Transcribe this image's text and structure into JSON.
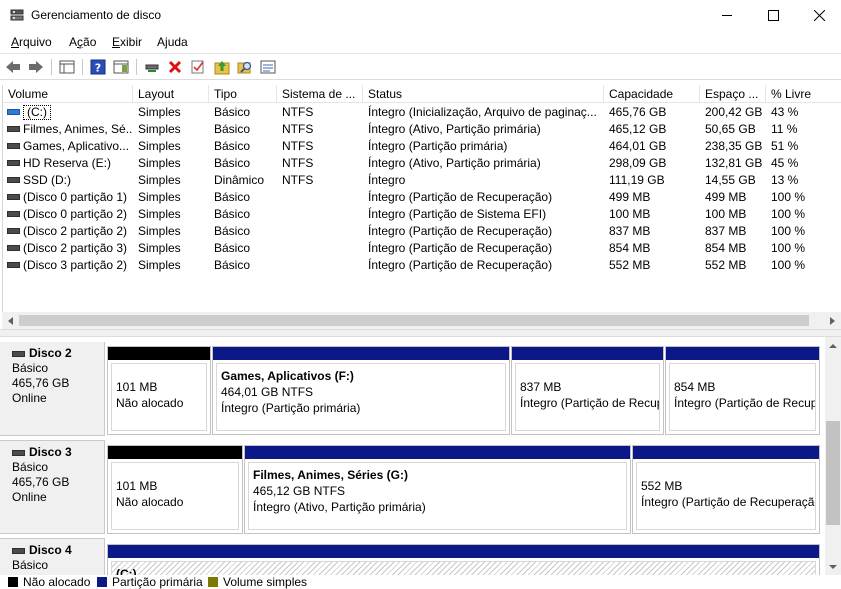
{
  "window": {
    "title": "Gerenciamento de disco",
    "controls": {
      "minimize": "minimize-icon",
      "maximize": "maximize-icon",
      "close": "close-icon"
    }
  },
  "menu": [
    {
      "label": "Arquivo",
      "u": "A",
      "rest": "rquivo"
    },
    {
      "label": "Ação",
      "u": "ç",
      "pre": "A",
      "rest": "ão"
    },
    {
      "label": "Exibir",
      "u": "E",
      "rest": "xibir"
    },
    {
      "label": "Ajuda",
      "u": "j",
      "pre": "A",
      "rest": "uda"
    }
  ],
  "menu_display": {
    "arquivo_u": "A",
    "arquivo_rest": "rquivo",
    "acao_pre": "A",
    "acao_u": "ç",
    "acao_rest": "ão",
    "exibir_u": "E",
    "exibir_rest": "xibir",
    "ajuda_pre": "A",
    "ajuda_u": "j",
    "ajuda_rest": "uda"
  },
  "toolbar": [
    "back-arrow-icon",
    "forward-arrow-icon",
    "console-tree-icon",
    "help-icon",
    "action-pane-icon",
    "connect-drive-icon",
    "delete-icon",
    "check-icon",
    "folder-up-icon",
    "search-icon",
    "properties-icon"
  ],
  "columns": {
    "volume": "Volume",
    "layout": "Layout",
    "tipo": "Tipo",
    "sistema": "Sistema de ...",
    "status": "Status",
    "capacidade": "Capacidade",
    "espaco": "Espaço ...",
    "livre": "% Livre"
  },
  "volumes": [
    {
      "volume": "(C:)",
      "layout": "Simples",
      "tipo": "Básico",
      "sistema": "NTFS",
      "status": "Íntegro (Inicialização, Arquivo de paginaç...",
      "capacidade": "465,76 GB",
      "espaco": "200,42 GB",
      "livre": "43 %"
    },
    {
      "volume": "Filmes, Animes, Sé...",
      "layout": "Simples",
      "tipo": "Básico",
      "sistema": "NTFS",
      "status": "Íntegro (Ativo, Partição primária)",
      "capacidade": "465,12 GB",
      "espaco": "50,65 GB",
      "livre": "11 %"
    },
    {
      "volume": "Games, Aplicativo...",
      "layout": "Simples",
      "tipo": "Básico",
      "sistema": "NTFS",
      "status": "Íntegro (Partição primária)",
      "capacidade": "464,01 GB",
      "espaco": "238,35 GB",
      "livre": "51 %"
    },
    {
      "volume": "HD Reserva (E:)",
      "layout": "Simples",
      "tipo": "Básico",
      "sistema": "NTFS",
      "status": "Íntegro (Ativo, Partição primária)",
      "capacidade": "298,09 GB",
      "espaco": "132,81 GB",
      "livre": "45 %"
    },
    {
      "volume": "SSD (D:)",
      "layout": "Simples",
      "tipo": "Dinâmico",
      "sistema": "NTFS",
      "status": "Íntegro",
      "capacidade": "111,19 GB",
      "espaco": "14,55 GB",
      "livre": "13 %"
    },
    {
      "volume": "(Disco 0 partição 1)",
      "layout": "Simples",
      "tipo": "Básico",
      "sistema": "",
      "status": "Íntegro (Partição de Recuperação)",
      "capacidade": "499 MB",
      "espaco": "499 MB",
      "livre": "100 %"
    },
    {
      "volume": "(Disco 0 partição 2)",
      "layout": "Simples",
      "tipo": "Básico",
      "sistema": "",
      "status": "Íntegro (Partição de Sistema EFI)",
      "capacidade": "100 MB",
      "espaco": "100 MB",
      "livre": "100 %"
    },
    {
      "volume": "(Disco 2 partição 2)",
      "layout": "Simples",
      "tipo": "Básico",
      "sistema": "",
      "status": "Íntegro (Partição de Recuperação)",
      "capacidade": "837 MB",
      "espaco": "837 MB",
      "livre": "100 %"
    },
    {
      "volume": "(Disco 2 partição 3)",
      "layout": "Simples",
      "tipo": "Básico",
      "sistema": "",
      "status": "Íntegro (Partição de Recuperação)",
      "capacidade": "854 MB",
      "espaco": "854 MB",
      "livre": "100 %"
    },
    {
      "volume": "(Disco 3 partição 2)",
      "layout": "Simples",
      "tipo": "Básico",
      "sistema": "",
      "status": "Íntegro (Partição de Recuperação)",
      "capacidade": "552 MB",
      "espaco": "552 MB",
      "livre": "100 %"
    }
  ],
  "disks": [
    {
      "name": "Disco 2",
      "type": "Básico",
      "size": "465,76 GB",
      "state": "Online",
      "partitions": [
        {
          "line1": "101 MB",
          "line2": "Não alocado"
        },
        {
          "name": "Games, Aplicativos  (F:)",
          "line1": "464,01 GB NTFS",
          "line2": "Íntegro (Partição primária)"
        },
        {
          "line1": "837 MB",
          "line2": "Íntegro (Partição de Recup"
        },
        {
          "line1": "854 MB",
          "line2": "Íntegro (Partição de Recup"
        }
      ]
    },
    {
      "name": "Disco 3",
      "type": "Básico",
      "size": "465,76 GB",
      "state": "Online",
      "partitions": [
        {
          "line1": "101 MB",
          "line2": "Não alocado"
        },
        {
          "name": "Filmes, Animes, Séries  (G:)",
          "line1": "465,12 GB NTFS",
          "line2": "Íntegro (Ativo, Partição primária)"
        },
        {
          "line1": "552 MB",
          "line2": "Íntegro (Partição de Recuperação"
        }
      ]
    },
    {
      "name": "Disco 4",
      "type": "Básico",
      "partitions": [
        {
          "name": "(C:)"
        }
      ]
    }
  ],
  "legend": [
    {
      "label": "Não alocado",
      "color": "#000000"
    },
    {
      "label": "Partição primária",
      "color": "#0c1788"
    },
    {
      "label": "Volume simples",
      "color": "#7a7a00"
    }
  ]
}
